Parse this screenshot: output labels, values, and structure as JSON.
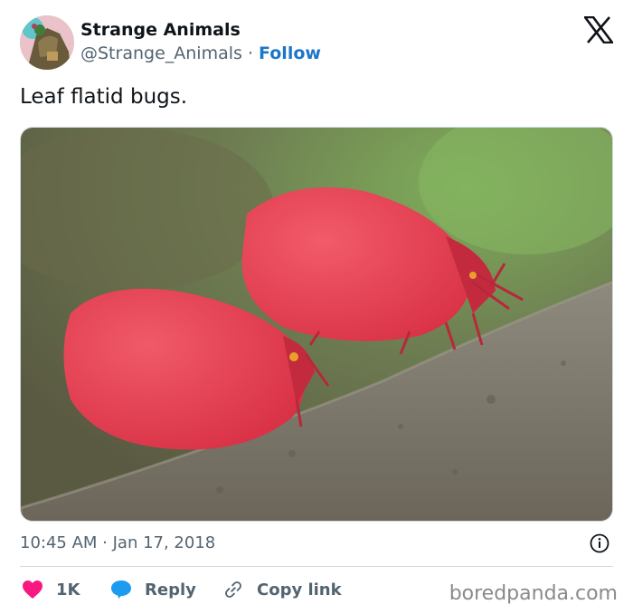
{
  "author": {
    "name": "Strange Animals",
    "handle": "@Strange_Animals",
    "separator": "·",
    "follow_label": "Follow"
  },
  "post": {
    "text": "Leaf flatid bugs.",
    "timestamp": "10:45 AM · Jan 17, 2018"
  },
  "actions": {
    "like_count": "1K",
    "reply_label": "Reply",
    "copy_link_label": "Copy link"
  },
  "watermark": "boredpanda.com",
  "colors": {
    "like": "#f91880",
    "reply": "#1d9bf0",
    "follow": "#1d77c7"
  },
  "icons": [
    "x-logo",
    "info-icon",
    "heart-icon",
    "reply-bubble-icon",
    "link-icon"
  ]
}
